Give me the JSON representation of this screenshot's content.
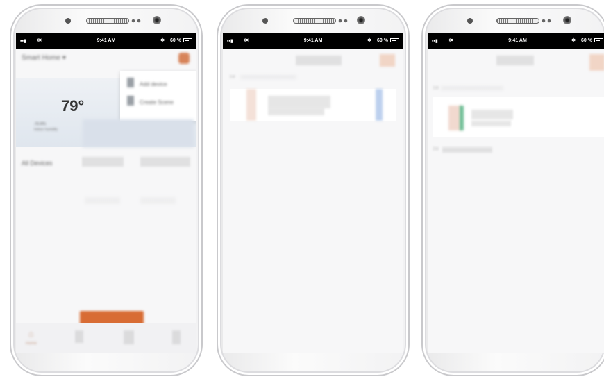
{
  "status_bar": {
    "time": "9:41 AM",
    "battery": "60 %",
    "signal": "▪▪▮",
    "wifi": "≋",
    "bluetooth": "✱"
  },
  "screen1": {
    "home_title": "Smart Home ▾",
    "temperature": "79°",
    "humidity": "79.4%",
    "humidity_sub": "Indoor humidity",
    "menu_items": [
      {
        "label": "Add device"
      },
      {
        "label": "Create Scene"
      }
    ],
    "all_devices": "All Devices",
    "tab_home_label": "Home"
  },
  "screen2": {
    "section_label": "1 d"
  },
  "screen3": {
    "section_label": "1 d",
    "section_label_2": "2 d"
  },
  "colors": {
    "accent": "#d86c34",
    "avatar": "#d7845a",
    "blue": "#bcd0ee",
    "green": "#6fbf96"
  }
}
